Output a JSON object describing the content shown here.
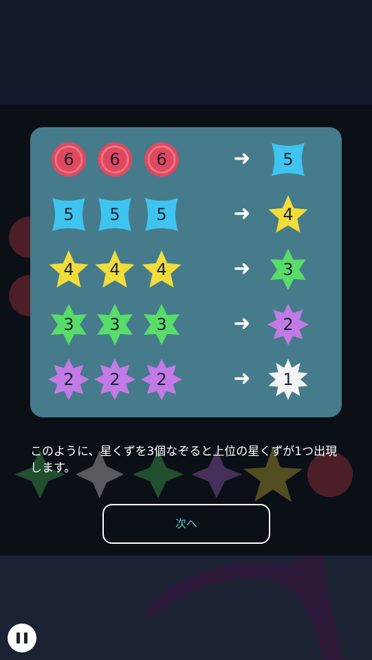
{
  "tutorial": {
    "rows": [
      {
        "inputs": [
          {
            "kind": "circle",
            "value": "6"
          },
          {
            "kind": "circle",
            "value": "6"
          },
          {
            "kind": "circle",
            "value": "6"
          }
        ],
        "arrow": "➜",
        "output": {
          "kind": "diamond4",
          "value": "5"
        }
      },
      {
        "inputs": [
          {
            "kind": "diamond4",
            "value": "5"
          },
          {
            "kind": "diamond4",
            "value": "5"
          },
          {
            "kind": "diamond4",
            "value": "5"
          }
        ],
        "arrow": "➜",
        "output": {
          "kind": "star5",
          "value": "4"
        }
      },
      {
        "inputs": [
          {
            "kind": "star5",
            "value": "4"
          },
          {
            "kind": "star5",
            "value": "4"
          },
          {
            "kind": "star5",
            "value": "4"
          }
        ],
        "arrow": "➜",
        "output": {
          "kind": "star6",
          "value": "3"
        }
      },
      {
        "inputs": [
          {
            "kind": "star6",
            "value": "3"
          },
          {
            "kind": "star6",
            "value": "3"
          },
          {
            "kind": "star6",
            "value": "3"
          }
        ],
        "arrow": "➜",
        "output": {
          "kind": "star8",
          "value": "2"
        }
      },
      {
        "inputs": [
          {
            "kind": "star8",
            "value": "2"
          },
          {
            "kind": "star8",
            "value": "2"
          },
          {
            "kind": "star8",
            "value": "2"
          }
        ],
        "arrow": "➜",
        "output": {
          "kind": "star10",
          "value": "1"
        }
      }
    ],
    "message": "このように、星くずを3個なぞると上位の星くずが1つ出現します。",
    "next_label": "次へ"
  },
  "colors": {
    "circle": "#e0485e",
    "diamond4": "#3fc4f0",
    "star5": "#f2dc3a",
    "star6": "#58dc6a",
    "star8": "#c27ae6",
    "star10": "#f4f4f4",
    "panel": "#467b8b",
    "button_text": "#5fc6d8"
  },
  "controls": {
    "pause_icon": "pause-icon"
  }
}
